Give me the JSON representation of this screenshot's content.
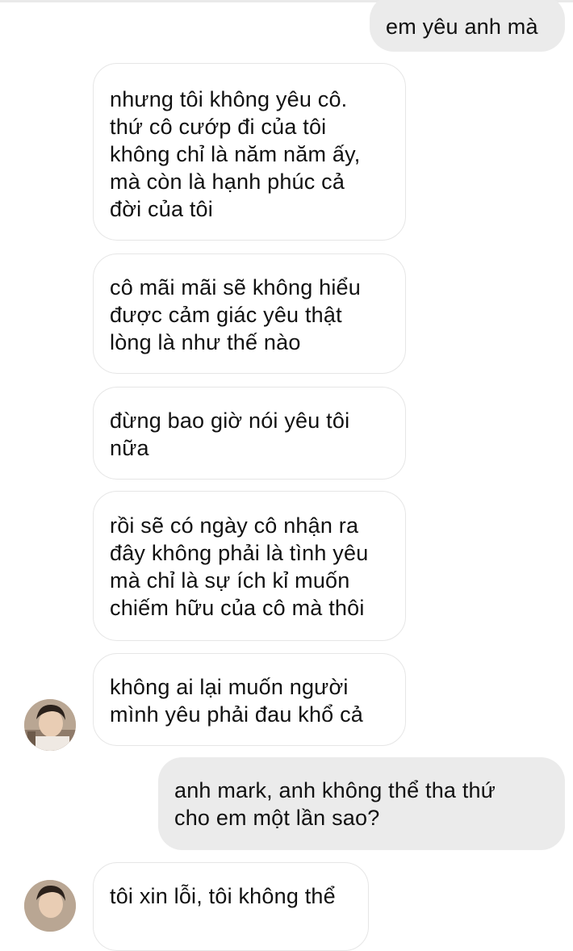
{
  "conversation": {
    "messages": [
      {
        "direction": "outgoing",
        "text": "em yêu anh mà"
      },
      {
        "direction": "incoming",
        "text": "nhưng tôi không yêu cô.\nthứ cô cướp đi của tôi\nkhông chỉ là năm năm ấy,\nmà còn là hạnh phúc cả\nđời của tôi"
      },
      {
        "direction": "incoming",
        "text": "cô mãi mãi sẽ không hiểu\nđược cảm giác yêu thật\nlòng là như thế nào"
      },
      {
        "direction": "incoming",
        "text": "đừng bao giờ nói yêu tôi\nnữa"
      },
      {
        "direction": "incoming",
        "text": "rồi sẽ có ngày cô nhận ra\nđây không phải là tình yêu\nmà chỉ là sự ích kỉ muốn\nchiếm hữu của cô mà thôi"
      },
      {
        "direction": "incoming",
        "text": "không ai lại muốn người\nmình yêu phải đau khổ cả"
      },
      {
        "direction": "outgoing",
        "text": "anh mark, anh không thể tha thứ\ncho em một lần sao?"
      },
      {
        "direction": "incoming",
        "text": "tôi xin lỗi, tôi không thể"
      }
    ]
  },
  "colors": {
    "outgoing_bubble": "#ebebeb",
    "incoming_bubble": "#ffffff",
    "incoming_border": "#e6e6e6",
    "text": "#111111"
  },
  "icons": {
    "contact_avatar": "avatar-photo"
  }
}
